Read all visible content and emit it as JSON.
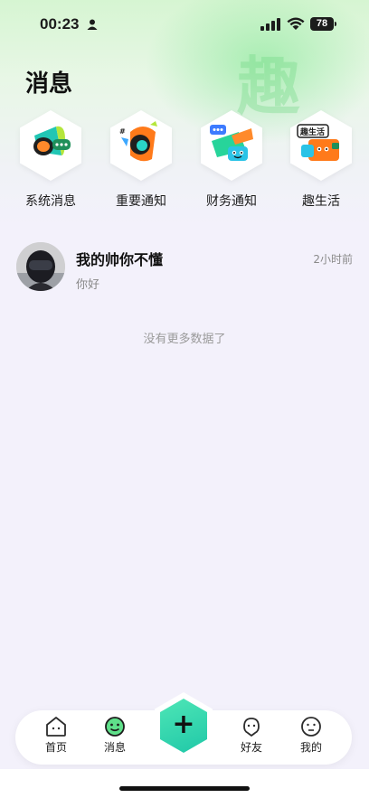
{
  "status_bar": {
    "time": "00:23",
    "battery": "78"
  },
  "header": {
    "title": "消息",
    "watermark": "趣"
  },
  "categories": [
    {
      "label": "系统消息",
      "icon": "megaphone-icon"
    },
    {
      "label": "重要通知",
      "icon": "alert-megaphone-icon"
    },
    {
      "label": "财务通知",
      "icon": "finance-chat-icon"
    },
    {
      "label": "趣生活",
      "icon": "fun-life-icon",
      "badge": "趣生活"
    }
  ],
  "messages": [
    {
      "name": "我的帅你不懂",
      "preview": "你好",
      "time": "2小时前"
    }
  ],
  "list_footer": "没有更多数据了",
  "tabbar": {
    "home": "首页",
    "messages": "消息",
    "add": "+",
    "friends": "好友",
    "mine": "我的"
  },
  "colors": {
    "accent": "#20c8a8",
    "background": "#f3f1fb",
    "header_green": "#d6f5d2"
  }
}
